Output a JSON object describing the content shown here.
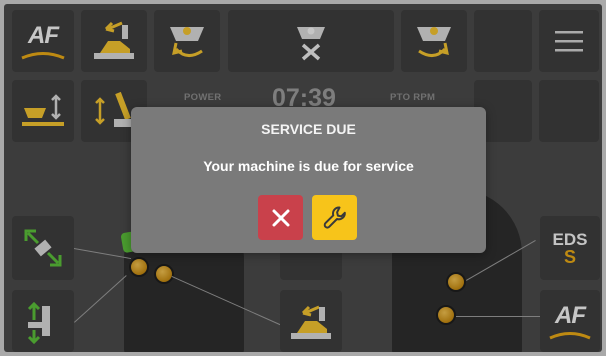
{
  "dialog": {
    "title": "SERVICE DUE",
    "message": "Your machine is due for service",
    "cancel_icon": "close-icon",
    "confirm_icon": "wrench-icon"
  },
  "status": {
    "power_label": "POWER",
    "time": "07:39",
    "pto_label": "PTO RPM"
  },
  "tiles": {
    "af_label": "AF",
    "eds_label": "EDS",
    "eds_mode": "S"
  },
  "colors": {
    "accent_yellow": "#f7c41a",
    "cancel_red": "#c9414b",
    "tile_bg": "#3d3d3d",
    "screen_bg": "#4a4a4a",
    "dialog_bg": "#7a7a7a",
    "eds_mode_color": "#e8a917"
  }
}
